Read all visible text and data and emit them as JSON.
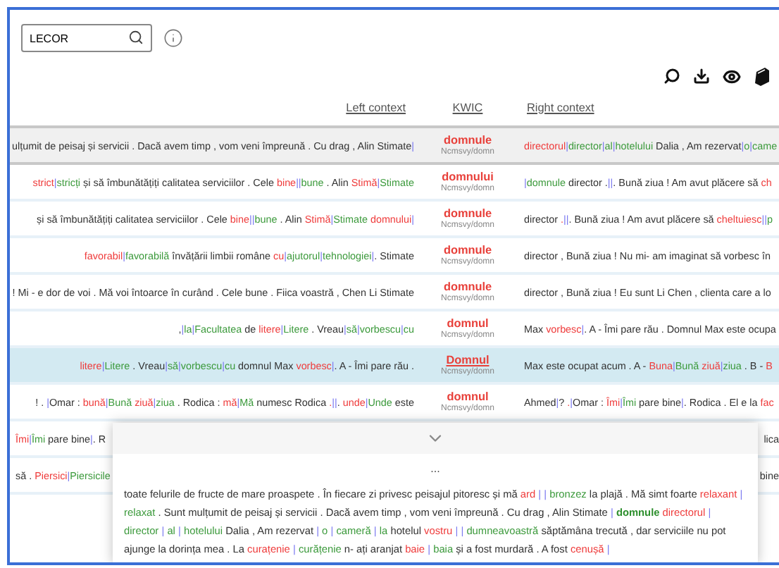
{
  "search": {
    "value": "LECOR"
  },
  "columns": [
    "Left context",
    "KWIC",
    "Right context"
  ],
  "rows": [
    {
      "kind": "pinned",
      "selected": false,
      "left_context": [
        {
          "kind": "plain",
          "text": "ulțumit de peisaj și servicii . Dacă avem timp , vom veni împreună . Cu drag , Alin Stimate"
        },
        {
          "kind": "bar",
          "text": "|"
        }
      ],
      "kwic": "domnule",
      "tag": "Ncmsvy/domn",
      "right_context": [
        {
          "kind": "error",
          "text": "directorul"
        },
        {
          "kind": "bar",
          "text": "|"
        },
        {
          "kind": "correction",
          "text": "director"
        },
        {
          "kind": "bar",
          "text": "|"
        },
        {
          "kind": "correction",
          "text": "al"
        },
        {
          "kind": "bar",
          "text": "|"
        },
        {
          "kind": "correction",
          "text": "hotelului"
        },
        {
          "kind": "plain",
          "text": " Dalia , Am rezervat"
        },
        {
          "kind": "bar",
          "text": "|"
        },
        {
          "kind": "correction",
          "text": "o"
        },
        {
          "kind": "bar",
          "text": "|"
        },
        {
          "kind": "correction",
          "text": "came"
        }
      ]
    },
    {
      "kind": "normal",
      "selected": false,
      "left_context": [
        {
          "kind": "error",
          "text": "strict"
        },
        {
          "kind": "bar",
          "text": "|"
        },
        {
          "kind": "correction",
          "text": "stricți"
        },
        {
          "kind": "plain",
          "text": " și să îmbunătățiți calitatea serviciilor . Cele "
        },
        {
          "kind": "error",
          "text": "bine"
        },
        {
          "kind": "bar",
          "text": "||"
        },
        {
          "kind": "correction",
          "text": "bune"
        },
        {
          "kind": "plain",
          "text": " . Alin "
        },
        {
          "kind": "error",
          "text": "Stimă"
        },
        {
          "kind": "bar",
          "text": "|"
        },
        {
          "kind": "correction",
          "text": "Stimate"
        }
      ],
      "kwic": "domnului",
      "tag": "Ncmsvy/domn",
      "right_context": [
        {
          "kind": "bar",
          "text": "|"
        },
        {
          "kind": "correction",
          "text": "domnule"
        },
        {
          "kind": "plain",
          "text": " director ."
        },
        {
          "kind": "bar",
          "text": "||"
        },
        {
          "kind": "plain",
          "text": ". Bună ziua ! Am avut plăcere să "
        },
        {
          "kind": "error",
          "text": "ch"
        }
      ]
    },
    {
      "kind": "normal",
      "selected": false,
      "left_context": [
        {
          "kind": "plain",
          "text": "și să îmbunătățiți calitatea serviciilor . Cele "
        },
        {
          "kind": "error",
          "text": "bine"
        },
        {
          "kind": "bar",
          "text": "||"
        },
        {
          "kind": "correction",
          "text": "bune"
        },
        {
          "kind": "plain",
          "text": " . Alin "
        },
        {
          "kind": "error",
          "text": "Stimă"
        },
        {
          "kind": "bar",
          "text": "|"
        },
        {
          "kind": "correction",
          "text": "Stimate"
        },
        {
          "kind": "error",
          "text": " domnului"
        },
        {
          "kind": "bar",
          "text": "|"
        }
      ],
      "kwic": "domnule",
      "tag": "Ncmsvy/domn",
      "right_context": [
        {
          "kind": "plain",
          "text": "director"
        },
        {
          "kind": "error",
          "text": " ."
        },
        {
          "kind": "bar",
          "text": "||"
        },
        {
          "kind": "plain",
          "text": ". Bună ziua ! Am avut plăcere să "
        },
        {
          "kind": "error",
          "text": "cheltuiesc"
        },
        {
          "kind": "bar",
          "text": "||"
        },
        {
          "kind": "correction",
          "text": "p"
        }
      ]
    },
    {
      "kind": "normal",
      "selected": false,
      "left_context": [
        {
          "kind": "error",
          "text": "favorabil"
        },
        {
          "kind": "bar",
          "text": "|"
        },
        {
          "kind": "correction",
          "text": "favorabilă"
        },
        {
          "kind": "plain",
          "text": " învățării limbii române "
        },
        {
          "kind": "error",
          "text": "cu"
        },
        {
          "kind": "bar",
          "text": "|"
        },
        {
          "kind": "correction",
          "text": "ajutorul"
        },
        {
          "kind": "bar",
          "text": "|"
        },
        {
          "kind": "correction",
          "text": "tehnologiei"
        },
        {
          "kind": "bar",
          "text": "|"
        },
        {
          "kind": "plain",
          "text": ". Stimate"
        }
      ],
      "kwic": "domnule",
      "tag": "Ncmsvy/domn",
      "right_context": [
        {
          "kind": "plain",
          "text": "director , Bună ziua ! Nu mi- am imaginat să vorbesc în"
        }
      ]
    },
    {
      "kind": "normal",
      "selected": false,
      "left_context": [
        {
          "kind": "plain",
          "text": "! Mi - e dor de voi . Mă voi întoarce în curând . Cele bune . Fiica voastră , Chen Li Stimate"
        }
      ],
      "kwic": "domnule",
      "tag": "Ncmsvy/domn",
      "right_context": [
        {
          "kind": "plain",
          "text": "director , Bună ziua ! Eu sunt Li Chen , clienta care a lo"
        }
      ]
    },
    {
      "kind": "normal",
      "selected": false,
      "left_context": [
        {
          "kind": "plain",
          "text": ","
        },
        {
          "kind": "bar",
          "text": "|"
        },
        {
          "kind": "correction",
          "text": "la"
        },
        {
          "kind": "bar",
          "text": "|"
        },
        {
          "kind": "correction",
          "text": "Facultatea"
        },
        {
          "kind": "plain",
          "text": " de "
        },
        {
          "kind": "error",
          "text": "litere"
        },
        {
          "kind": "bar",
          "text": "|"
        },
        {
          "kind": "correction",
          "text": "Litere"
        },
        {
          "kind": "plain",
          "text": " . Vreau"
        },
        {
          "kind": "bar",
          "text": "|"
        },
        {
          "kind": "correction",
          "text": "să"
        },
        {
          "kind": "bar",
          "text": "|"
        },
        {
          "kind": "correction",
          "text": "vorbescu"
        },
        {
          "kind": "bar",
          "text": "|"
        },
        {
          "kind": "correction",
          "text": "cu"
        }
      ],
      "kwic": "domnul",
      "tag": "Ncmsvy/domn",
      "right_context": [
        {
          "kind": "plain",
          "text": "Max "
        },
        {
          "kind": "error",
          "text": "vorbesc"
        },
        {
          "kind": "bar",
          "text": "|"
        },
        {
          "kind": "plain",
          "text": ". A - Îmi pare rău . Domnul Max este ocupa"
        }
      ]
    },
    {
      "kind": "normal",
      "selected": true,
      "left_context": [
        {
          "kind": "error",
          "text": "litere"
        },
        {
          "kind": "bar",
          "text": "|"
        },
        {
          "kind": "correction",
          "text": "Litere"
        },
        {
          "kind": "plain",
          "text": " . Vreau"
        },
        {
          "kind": "bar",
          "text": "|"
        },
        {
          "kind": "correction",
          "text": "să"
        },
        {
          "kind": "bar",
          "text": "|"
        },
        {
          "kind": "correction",
          "text": "vorbescu"
        },
        {
          "kind": "bar",
          "text": "|"
        },
        {
          "kind": "correction",
          "text": "cu"
        },
        {
          "kind": "plain",
          "text": " domnul Max "
        },
        {
          "kind": "error",
          "text": "vorbesc"
        },
        {
          "kind": "bar",
          "text": "|"
        },
        {
          "kind": "plain",
          "text": ". A - Îmi pare rău ."
        }
      ],
      "kwic": "Domnul",
      "tag": "Ncmsvy/domn",
      "right_context": [
        {
          "kind": "plain",
          "text": "Max este ocupat acum . A - "
        },
        {
          "kind": "error",
          "text": "Buna"
        },
        {
          "kind": "bar",
          "text": "|"
        },
        {
          "kind": "correction",
          "text": "Bună"
        },
        {
          "kind": "error",
          "text": " ziuă"
        },
        {
          "kind": "bar",
          "text": "|"
        },
        {
          "kind": "correction",
          "text": "ziua"
        },
        {
          "kind": "plain",
          "text": " . B - "
        },
        {
          "kind": "error",
          "text": "B"
        }
      ]
    },
    {
      "kind": "normal",
      "selected": false,
      "left_context": [
        {
          "kind": "plain",
          "text": "! . "
        },
        {
          "kind": "bar",
          "text": "|"
        },
        {
          "kind": "plain",
          "text": "Omar : "
        },
        {
          "kind": "error",
          "text": "bună"
        },
        {
          "kind": "bar",
          "text": "|"
        },
        {
          "kind": "correction",
          "text": "Bună"
        },
        {
          "kind": "error",
          "text": " ziuă"
        },
        {
          "kind": "bar",
          "text": "|"
        },
        {
          "kind": "correction",
          "text": "ziua"
        },
        {
          "kind": "plain",
          "text": " . Rodica : "
        },
        {
          "kind": "error",
          "text": "mă"
        },
        {
          "kind": "bar",
          "text": "|"
        },
        {
          "kind": "correction",
          "text": "Mă"
        },
        {
          "kind": "plain",
          "text": " numesc Rodica "
        },
        {
          "kind": "error",
          "text": "."
        },
        {
          "kind": "bar",
          "text": "||"
        },
        {
          "kind": "plain",
          "text": ". "
        },
        {
          "kind": "error",
          "text": "unde"
        },
        {
          "kind": "bar",
          "text": "|"
        },
        {
          "kind": "correction",
          "text": "Unde"
        },
        {
          "kind": "plain",
          "text": " este"
        }
      ],
      "kwic": "domnul",
      "tag": "Ncmsvy/domn",
      "right_context": [
        {
          "kind": "plain",
          "text": "Ahmed"
        },
        {
          "kind": "bar",
          "text": "|"
        },
        {
          "kind": "plain",
          "text": "? "
        },
        {
          "kind": "error",
          "text": "."
        },
        {
          "kind": "bar",
          "text": "|"
        },
        {
          "kind": "plain",
          "text": "Omar : "
        },
        {
          "kind": "error",
          "text": "Îmi"
        },
        {
          "kind": "bar",
          "text": "|"
        },
        {
          "kind": "correction",
          "text": "Îmi"
        },
        {
          "kind": "plain",
          "text": " pare bine"
        },
        {
          "kind": "bar",
          "text": "|"
        },
        {
          "kind": "plain",
          "text": ". Rodica . El e la "
        },
        {
          "kind": "error",
          "text": "fac"
        }
      ]
    },
    {
      "kind": "covered",
      "selected": false,
      "left_context": [
        {
          "kind": "error",
          "text": "Îmi"
        },
        {
          "kind": "bar",
          "text": "|"
        },
        {
          "kind": "correction",
          "text": "Îmi"
        },
        {
          "kind": "plain",
          "text": " pare bine"
        },
        {
          "kind": "bar",
          "text": "|"
        },
        {
          "kind": "plain",
          "text": ". R"
        }
      ],
      "right_context": [
        {
          "kind": "plain",
          "text": "lica"
        }
      ]
    },
    {
      "kind": "covered",
      "selected": false,
      "left_context": [
        {
          "kind": "plain",
          "text": "să . "
        },
        {
          "kind": "error",
          "text": "Piersici"
        },
        {
          "kind": "bar",
          "text": "|"
        },
        {
          "kind": "correction",
          "text": "Piersicile"
        }
      ],
      "right_context": [
        {
          "kind": "plain",
          "text": "bine"
        }
      ]
    }
  ],
  "detail": {
    "ellipsis": "...",
    "text": [
      {
        "kind": "plain",
        "text": "toate felurile de fructe de mare proaspete . În fiecare zi privesc peisajul pitoresc și mă "
      },
      {
        "kind": "error",
        "text": "ard"
      },
      {
        "kind": "bar",
        "text": " | | "
      },
      {
        "kind": "correction",
        "text": "bronzez"
      },
      {
        "kind": "plain",
        "text": " la plajă . Mă simt foarte "
      },
      {
        "kind": "error",
        "text": "relaxant"
      },
      {
        "kind": "bar",
        "text": " | "
      },
      {
        "kind": "correction",
        "text": "relaxat"
      },
      {
        "kind": "plain",
        "text": " . Sunt mulțumit de peisaj și servicii . Dacă avem timp , vom veni împreună . Cu drag , Alin Stimate "
      },
      {
        "kind": "bar",
        "text": "| "
      },
      {
        "kind": "keyword",
        "text": "domnule"
      },
      {
        "kind": "error",
        "text": " directorul"
      },
      {
        "kind": "bar",
        "text": " | "
      },
      {
        "kind": "correction",
        "text": "director"
      },
      {
        "kind": "bar",
        "text": " | "
      },
      {
        "kind": "correction",
        "text": "al"
      },
      {
        "kind": "bar",
        "text": " | "
      },
      {
        "kind": "correction",
        "text": "hotelului"
      },
      {
        "kind": "plain",
        "text": " Dalia , Am rezervat "
      },
      {
        "kind": "bar",
        "text": "| "
      },
      {
        "kind": "correction",
        "text": "o"
      },
      {
        "kind": "bar",
        "text": " | "
      },
      {
        "kind": "correction",
        "text": "cameră"
      },
      {
        "kind": "bar",
        "text": " | "
      },
      {
        "kind": "correction",
        "text": "la"
      },
      {
        "kind": "plain",
        "text": " hotelul "
      },
      {
        "kind": "error",
        "text": "vostru"
      },
      {
        "kind": "bar",
        "text": " | | "
      },
      {
        "kind": "correction",
        "text": "dumneavoastră"
      },
      {
        "kind": "plain",
        "text": " săptămâna trecută , dar serviciile nu pot ajunge la dorința mea . La "
      },
      {
        "kind": "error",
        "text": "curațenie"
      },
      {
        "kind": "bar",
        "text": " | "
      },
      {
        "kind": "correction",
        "text": "curățenie"
      },
      {
        "kind": "plain",
        "text": " n- ați aranjat "
      },
      {
        "kind": "error",
        "text": "baie"
      },
      {
        "kind": "bar",
        "text": " | "
      },
      {
        "kind": "correction",
        "text": "baia"
      },
      {
        "kind": "plain",
        "text": " și a fost murdară . A fost "
      },
      {
        "kind": "error",
        "text": "cenușă"
      },
      {
        "kind": "bar",
        "text": " |"
      }
    ]
  }
}
